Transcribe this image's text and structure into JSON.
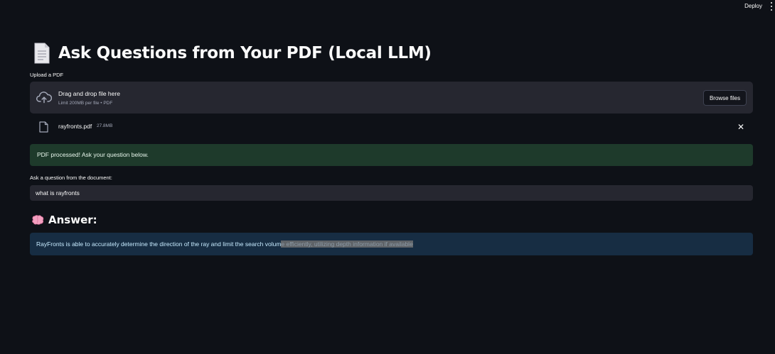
{
  "topbar": {
    "deploy_label": "Deploy",
    "menu_icon": "kebab-menu-icon"
  },
  "header": {
    "icon": "document-icon",
    "title": "Ask Questions from Your PDF (Local LLM)"
  },
  "uploader": {
    "label": "Upload a PDF",
    "icon": "cloud-upload-icon",
    "drop_title": "Drag and drop file here",
    "drop_subtitle": "Limit 200MB per file • PDF",
    "browse_label": "Browse files"
  },
  "uploaded_file": {
    "icon": "file-icon",
    "name": "rayfronts.pdf",
    "size": "27.8MB",
    "remove_icon": "close-icon"
  },
  "status": {
    "message": "PDF processed! Ask your question below.",
    "color": "#1e3a2b"
  },
  "question": {
    "label": "Ask a question from the document:",
    "value": "what is rayfronts"
  },
  "answer": {
    "icon": "brain-icon",
    "heading": "Answer:",
    "text_part1": "RayFronts is able to accurately determine the direction of the ray and limit the search volum",
    "text_selected": "e efficiently, utilizing depth information if available",
    "color": "#172d43"
  }
}
